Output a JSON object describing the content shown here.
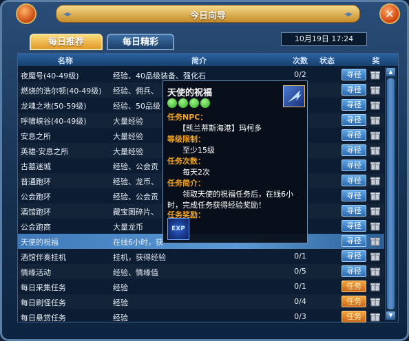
{
  "window": {
    "title": "今日向导",
    "close_glyph": "✕"
  },
  "tabs": [
    {
      "label": "每日推荐",
      "active": true
    },
    {
      "label": "每日精彩",
      "active": false
    }
  ],
  "datetime": "10月19日 17:24",
  "columns": {
    "name": "名称",
    "desc": "简介",
    "count": "次数",
    "status": "状态",
    "reward": "奖"
  },
  "rows": [
    {
      "name": "夜魔号(40-49级)",
      "desc": "经验、40品级装备、强化石",
      "count": "0/2",
      "action": "寻径"
    },
    {
      "name": "燃烧的浩尔顿(40-49级)",
      "desc": "经验、佣兵、",
      "count": "",
      "action": "寻径"
    },
    {
      "name": "龙魂之地(50-59级)",
      "desc": "经验、50品级",
      "count": "",
      "action": "寻径"
    },
    {
      "name": "呼啸峡谷(40-49级)",
      "desc": "大量经验",
      "count": "",
      "action": "寻径"
    },
    {
      "name": "安息之所",
      "desc": "大量经验",
      "count": "",
      "action": "寻径"
    },
    {
      "name": "英雄·安息之所",
      "desc": "大量经验",
      "count": "",
      "action": "寻径"
    },
    {
      "name": "古墓迷城",
      "desc": "经验、公会贡",
      "count": "",
      "action": "寻径"
    },
    {
      "name": "普通跑环",
      "desc": "经验、龙币、",
      "count": "",
      "action": "寻径"
    },
    {
      "name": "公会跑环",
      "desc": "经验、公会贡",
      "count": "",
      "action": "寻径"
    },
    {
      "name": "酒馆跑环",
      "desc": "藏宝图碎片、",
      "count": "",
      "action": "寻径"
    },
    {
      "name": "公会跑商",
      "desc": "大量龙币",
      "count": "",
      "action": "寻径"
    },
    {
      "name": "天使的祝福",
      "desc": "在线6小时，获",
      "count": "",
      "action": "寻径"
    },
    {
      "name": "酒馆伴奏挂机",
      "desc": "挂机，获得经验",
      "count": "0/1",
      "action": "寻径"
    },
    {
      "name": "情缘活动",
      "desc": "经验、情缘值",
      "count": "0/5",
      "action": "寻径"
    },
    {
      "name": "每日采集任务",
      "desc": "经验",
      "count": "0/1",
      "action": "任务"
    },
    {
      "name": "每日刷怪任务",
      "desc": "经验",
      "count": "0/4",
      "action": "任务"
    },
    {
      "name": "每日悬赏任务",
      "desc": "经验",
      "count": "0/3",
      "action": "任务"
    }
  ],
  "selected_row": 11,
  "tooltip": {
    "title": "天使的祝福",
    "stars": 4,
    "npc_label": "任务NPC：",
    "npc_value": "【凯兰蒂斯海港】玛柯多",
    "level_label": "等级限制：",
    "level_value": "至少15级",
    "times_label": "任务次数：",
    "times_value": "每天2次",
    "intro_label": "任务简介：",
    "intro_line1": "领取天使的祝福任务后，在线6小",
    "intro_line2": "时，完成任务获得经验奖励！",
    "reward_label": "任务奖励：",
    "reward_icon": "EXP"
  },
  "colors": {
    "accent": "#e19a2a",
    "selected": "#5b9ad6",
    "label_orange": "#f3a422"
  }
}
